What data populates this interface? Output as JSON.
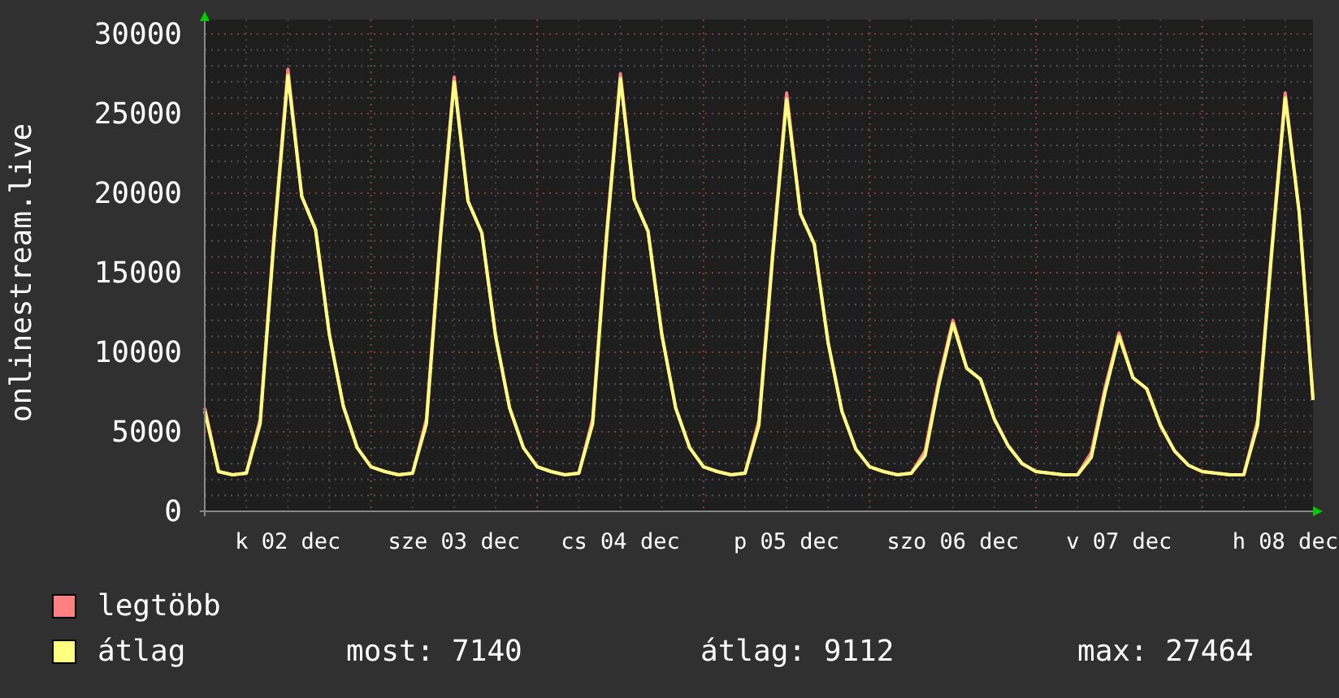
{
  "graph": {
    "chart_data": {
      "type": "line",
      "ylabel": "onlinestream.live",
      "categories": [
        null,
        null,
        null,
        null,
        null,
        null,
        "k 02 dec",
        null,
        null,
        null,
        null,
        null,
        null,
        null,
        null,
        null,
        null,
        null,
        "sze 03 dec",
        null,
        null,
        null,
        null,
        null,
        null,
        null,
        null,
        null,
        null,
        null,
        "cs 04 dec",
        null,
        null,
        null,
        null,
        null,
        null,
        null,
        null,
        null,
        null,
        null,
        "p 05 dec",
        null,
        null,
        null,
        null,
        null,
        null,
        null,
        null,
        null,
        null,
        null,
        "szo 06 dec",
        null,
        null,
        null,
        null,
        null,
        null,
        null,
        null,
        null,
        null,
        null,
        "v 07 dec",
        null,
        null,
        null,
        null,
        null,
        null,
        null,
        null,
        null,
        null,
        null,
        "h 08 dec",
        null,
        null
      ],
      "grid": true,
      "ylim": [
        0,
        30000
      ],
      "yticks": [
        0,
        5000,
        10000,
        15000,
        20000,
        25000,
        30000
      ],
      "series": [
        {
          "name": "legtöbb",
          "color": "#ff8080",
          "values": [
            6500,
            2500,
            2300,
            2400,
            5800,
            17300,
            27800,
            19800,
            17700,
            11100,
            6600,
            4000,
            2800,
            2500,
            2300,
            2400,
            5800,
            17300,
            27300,
            19500,
            17500,
            11000,
            6500,
            4000,
            2800,
            2500,
            2300,
            2400,
            5800,
            17400,
            27500,
            19600,
            17600,
            11100,
            6500,
            4000,
            2800,
            2500,
            2300,
            2400,
            5700,
            16300,
            26300,
            18700,
            16800,
            10600,
            6300,
            3900,
            2800,
            2500,
            2300,
            2400,
            3800,
            8300,
            12000,
            9000,
            8300,
            5800,
            4100,
            3000,
            2500,
            2400,
            2300,
            2300,
            3700,
            7800,
            11200,
            8400,
            7700,
            5400,
            3800,
            2900,
            2500,
            2400,
            2300,
            2300,
            5700,
            16300,
            26300,
            18800,
            7100
          ]
        },
        {
          "name": "átlag",
          "color": "#ffff80",
          "values": [
            6300,
            2500,
            2300,
            2400,
            5500,
            17000,
            27400,
            19800,
            17700,
            11100,
            6600,
            4000,
            2800,
            2500,
            2300,
            2400,
            5500,
            17000,
            27000,
            19500,
            17500,
            11000,
            6500,
            4000,
            2800,
            2500,
            2300,
            2400,
            5500,
            17100,
            27200,
            19600,
            17600,
            11100,
            6500,
            4000,
            2800,
            2500,
            2300,
            2400,
            5400,
            16000,
            25900,
            18700,
            16800,
            10600,
            6300,
            3900,
            2800,
            2500,
            2300,
            2400,
            3500,
            8000,
            11800,
            9000,
            8300,
            5800,
            4100,
            3000,
            2500,
            2400,
            2300,
            2300,
            3400,
            7500,
            11000,
            8400,
            7700,
            5400,
            3800,
            2900,
            2500,
            2400,
            2300,
            2300,
            5400,
            16000,
            26000,
            18800,
            7000
          ]
        }
      ]
    }
  },
  "stats": [
    "most: 7140",
    "átlag: 9112",
    "max: 27464"
  ]
}
